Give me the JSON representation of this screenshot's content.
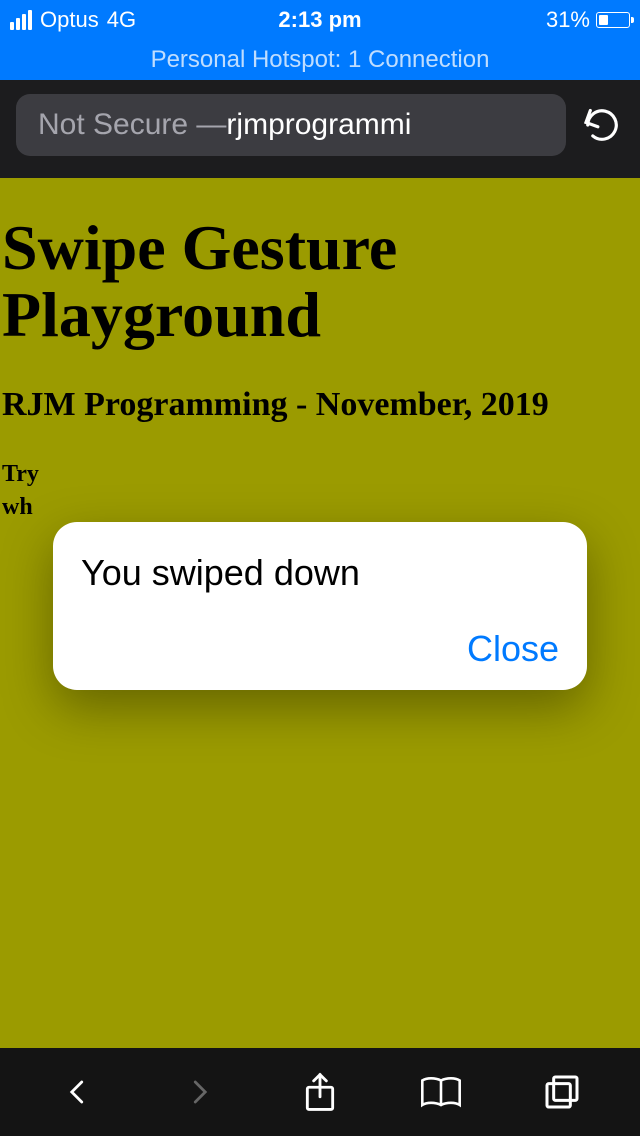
{
  "status": {
    "carrier": "Optus",
    "network": "4G",
    "time": "2:13 pm",
    "battery_pct": "31%"
  },
  "hotspot": {
    "label": "Personal Hotspot: 1 Connection"
  },
  "addressbar": {
    "prefix": "Not Secure — ",
    "host_visible": "rjmprogrammi"
  },
  "page": {
    "title": "Swipe Gesture Playground",
    "byline": "RJM Programming - November, 2019",
    "instruction_line1": "Try",
    "instruction_line2": "wh"
  },
  "alert": {
    "message": "You swiped down",
    "close_label": "Close"
  }
}
